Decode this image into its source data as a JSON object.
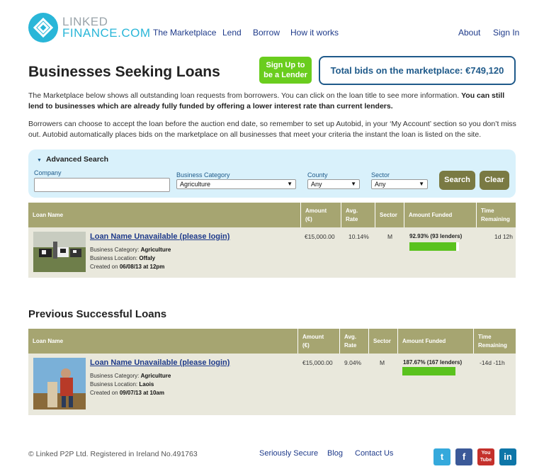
{
  "brand": {
    "line1": "LINKED",
    "line2": "FINANCE.COM"
  },
  "nav": {
    "marketplace": "The Marketplace",
    "lend": "Lend",
    "borrow": "Borrow",
    "how": "How it works",
    "about": "About",
    "signin": "Sign In"
  },
  "page": {
    "title": "Businesses Seeking Loans",
    "signup_line1": "Sign Up to",
    "signup_line2": "be a Lender",
    "total_bids": "Total bids on the marketplace: €749,120",
    "intro1_normal": "The Marketplace below shows all outstanding loan requests from borrowers. You can click on the loan title to see more information. ",
    "intro1_bold": "You can still lend to businesses which are already fully funded by offering a lower interest rate than current lenders.",
    "intro2": "Borrowers can choose to accept the loan before the auction end date, so remember to set up Autobid, in your ‘My Account’ section so you don’t miss out. Autobid automatically places bids on the marketplace on all businesses that meet your criteria the instant the loan is listed on the site."
  },
  "search": {
    "title": "Advanced Search",
    "company_label": "Company",
    "company_value": "",
    "category_label": "Business Category",
    "category_value": "Agriculture",
    "county_label": "County",
    "county_value": "Any",
    "sector_label": "Sector",
    "sector_value": "Any",
    "search_btn": "Search",
    "clear_btn": "Clear"
  },
  "columns": {
    "name": "Loan Name",
    "amount1": "Amount",
    "amount2": "(€)",
    "rate1": "Avg.",
    "rate2": "Rate",
    "sector": "Sector",
    "funded": "Amount Funded",
    "time1": "Time",
    "time2": "Remaining"
  },
  "labels": {
    "category": "Business Category: ",
    "location": "Business Location: ",
    "created": "Created on "
  },
  "current_loans": [
    {
      "title": "Loan Name Unavailable (please login)",
      "category": "Agriculture",
      "location": "Offaly",
      "created": "06/08/13 at 12pm",
      "amount": "€15,000.00",
      "rate": "10.14%",
      "sector": "M",
      "funded": "92.93% (93 lenders)",
      "funded_pct": 92.93,
      "time": "1d 12h"
    }
  ],
  "previous": {
    "title": "Previous Successful Loans",
    "loans": [
      {
        "title": "Loan Name Unavailable (please login)",
        "category": "Agriculture",
        "location": "Laois",
        "created": "09/07/13 at 10am",
        "amount": "€15,000.00",
        "rate": "9.04%",
        "sector": "M",
        "funded": "187.67% (167 lenders)",
        "funded_pct": 187.67,
        "time": "-14d -11h"
      }
    ]
  },
  "footer": {
    "copyright": "© Linked P2P Ltd. Registered in Ireland No.491763",
    "secure": "Seriously Secure",
    "blog": "Blog",
    "contact": "Contact Us",
    "twitter": "t",
    "facebook": "f",
    "youtube": "You Tube",
    "linkedin": "in"
  },
  "colors": {
    "accent": "#29b6d8",
    "nav_link": "#1e3a8a",
    "signup_green": "#6acd1e",
    "table_header": "#a6a571",
    "progress_green": "#5ac21e"
  }
}
